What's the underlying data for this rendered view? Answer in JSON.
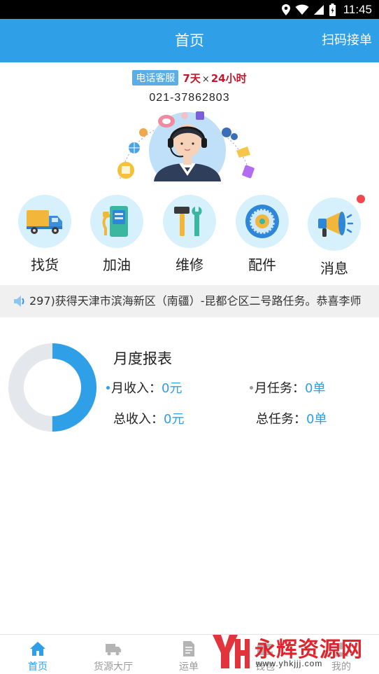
{
  "status_bar": {
    "time": "11:45"
  },
  "header": {
    "title": "首页",
    "scan_label": "扫码接单"
  },
  "service": {
    "tag": "电话客服",
    "days": "7天",
    "times": "×",
    "hours": "24小时",
    "phone": "021-37862803"
  },
  "quick_menu": [
    {
      "label": "找货",
      "icon": "truck-icon"
    },
    {
      "label": "加油",
      "icon": "fuel-pump-icon"
    },
    {
      "label": "维修",
      "icon": "wrench-hammer-icon"
    },
    {
      "label": "配件",
      "icon": "wheel-icon"
    },
    {
      "label": "消息",
      "icon": "megaphone-icon",
      "has_unread": true
    }
  ],
  "ticker": {
    "text": "297)获得天津市滨海新区（南疆）-昆都仑区二号路任务。恭喜李师"
  },
  "report": {
    "title": "月度报表",
    "monthly_income_label": "月收入：",
    "monthly_income_value": "0元",
    "monthly_tasks_label": "月任务：",
    "monthly_tasks_value": "0单",
    "total_income_label": "总收入：",
    "total_income_value": "0元",
    "total_tasks_label": "总任务：",
    "total_tasks_value": "0单",
    "donut_fill_fraction": 0.5
  },
  "tabs": [
    {
      "label": "首页",
      "active": true
    },
    {
      "label": "货源大厅"
    },
    {
      "label": "运单"
    },
    {
      "label": "钱包"
    },
    {
      "label": "我的"
    }
  ],
  "watermark": {
    "title": "永辉资源网",
    "url": "www.yhkjjj.com"
  },
  "colors": {
    "accent": "#2f9fe8",
    "badge": "#f2474f",
    "icon_bg": "#d6f1fb",
    "hotline_red": "#c4172a"
  }
}
